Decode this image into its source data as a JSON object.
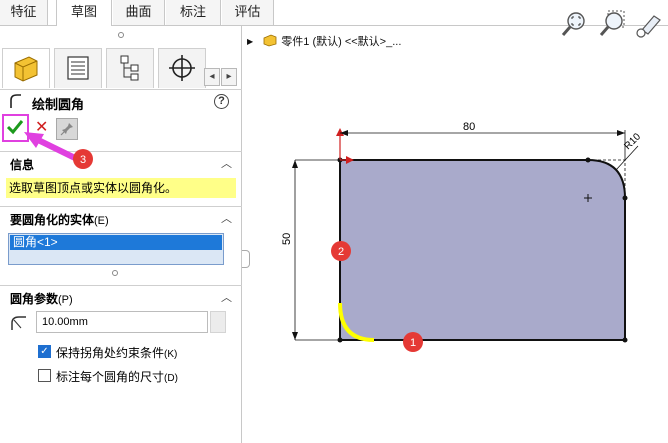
{
  "tabs": [
    "特征",
    "草图",
    "曲面",
    "标注",
    "评估"
  ],
  "active_tab": "草图",
  "feature": {
    "title": "绘制圆角",
    "help": "?"
  },
  "sections": {
    "info": {
      "title": "信息",
      "text": "选取草图顶点或实体以圆角化。"
    },
    "entities": {
      "title": "要圆角化的实体",
      "hotkey": "(E)",
      "items": [
        "圆角<1>"
      ]
    },
    "params": {
      "title": "圆角参数",
      "hotkey": "(P)",
      "radius": "10.00mm",
      "keep_corner": {
        "label": "保持拐角处约束条件",
        "hotkey": "(K)",
        "checked": true
      },
      "dim_each": {
        "label": "标注每个圆角的尺寸",
        "hotkey": "(D)",
        "checked": false
      }
    }
  },
  "breadcrumb": "零件1 (默认) <<默认>_...",
  "drawing": {
    "dim_width": "80",
    "dim_height": "50",
    "dim_radius": "R10",
    "callouts": [
      "1",
      "2",
      "3"
    ]
  },
  "colors": {
    "sketch_fill": "#a9aacb",
    "highlight": "#ffff00",
    "callout": "#e53935",
    "annotation": "#e040e0",
    "selection": "#1e79d9"
  }
}
